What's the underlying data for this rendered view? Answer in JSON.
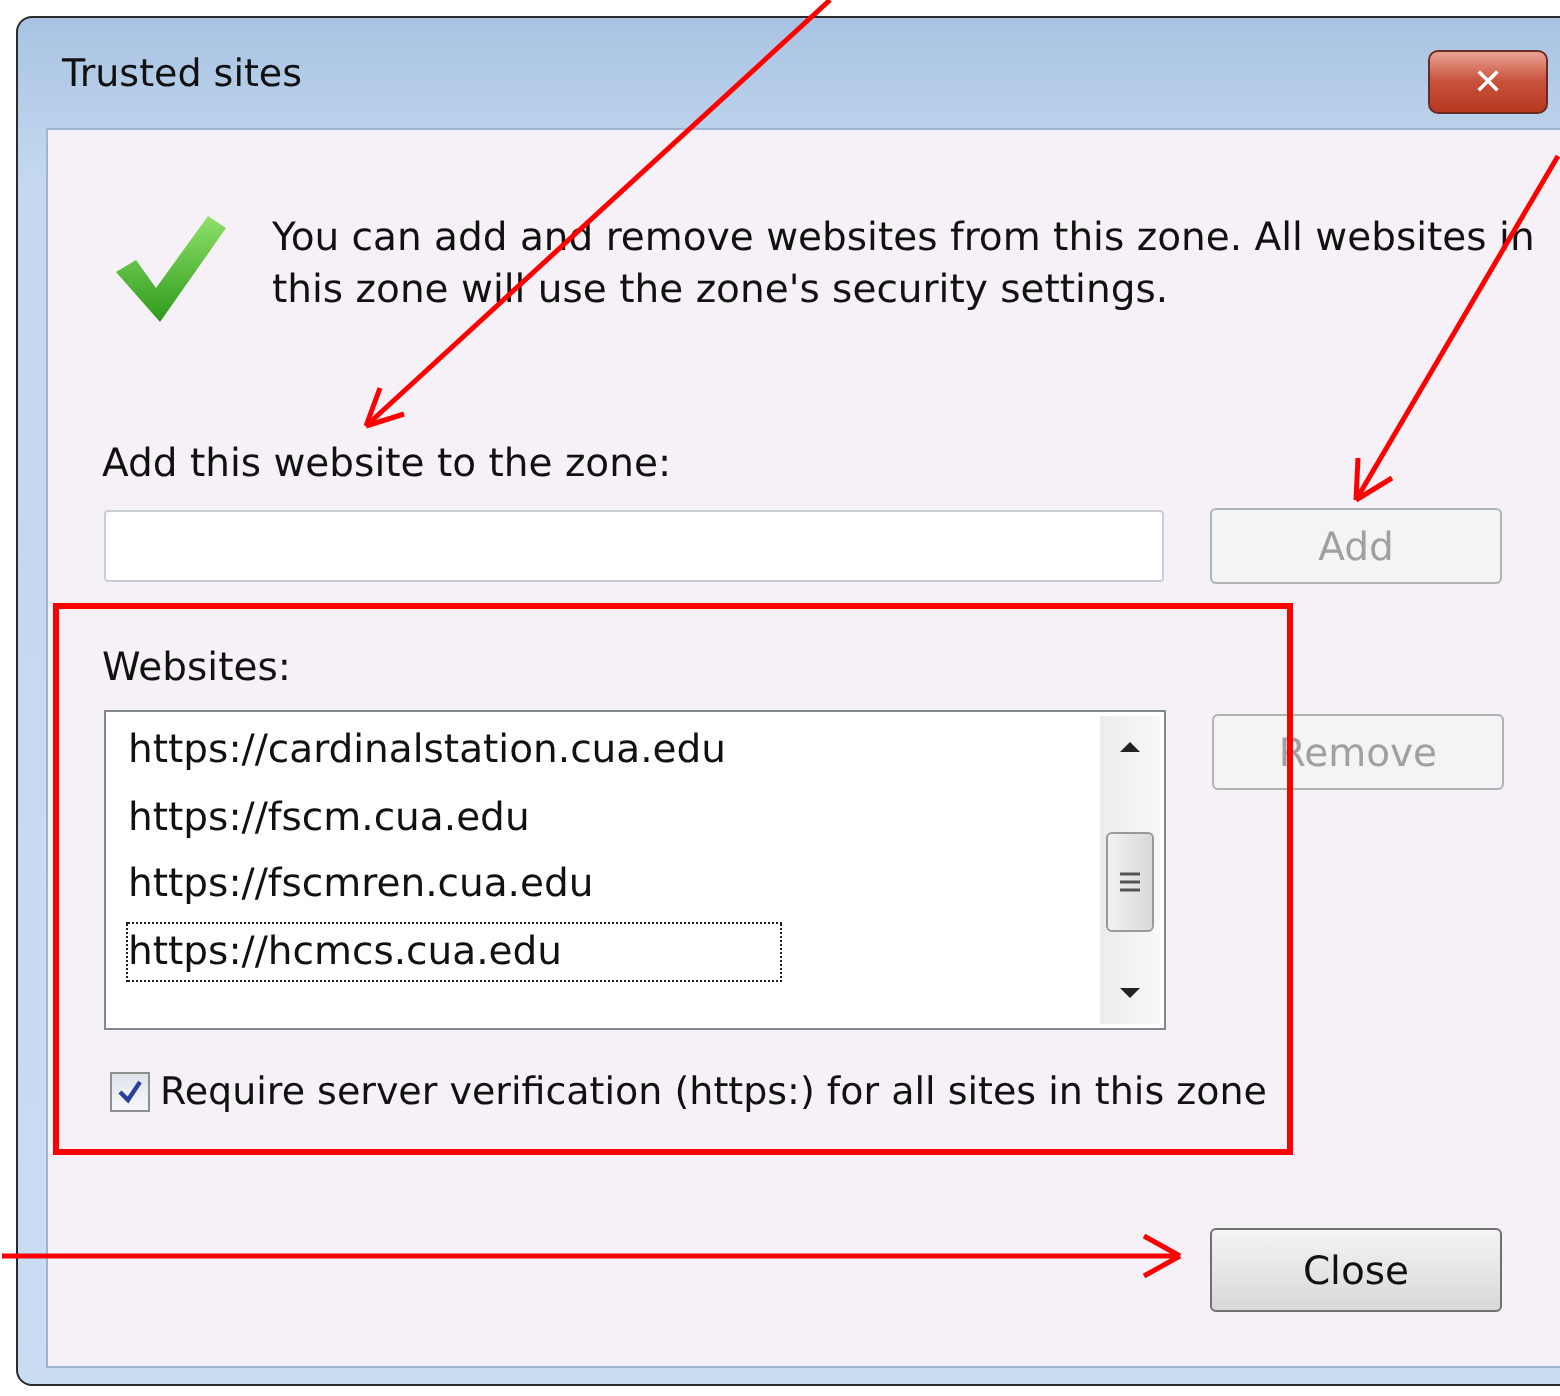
{
  "window": {
    "title": "Trusted sites",
    "close_symbol": "✕"
  },
  "message": "You can add and remove websites from this zone. All websites in this zone will use the zone's security settings.",
  "add_field": {
    "label": "Add this website to the zone:"
  },
  "add_button": {
    "label": "Add",
    "disabled": true
  },
  "websites": {
    "label": "Websites:",
    "items": [
      {
        "text": "https://cardinalstation.cua.edu",
        "focused": false
      },
      {
        "text": "https://fscm.cua.edu",
        "focused": false
      },
      {
        "text": "https://fscmren.cua.edu",
        "focused": false
      },
      {
        "text": "https://hcmcs.cua.edu",
        "focused": true
      }
    ]
  },
  "remove_button": {
    "label": "Remove",
    "disabled": true
  },
  "https_checkbox": {
    "label": "Require server verification (https:) for all sites in this zone",
    "checked": true
  },
  "close_button": {
    "label": "Close",
    "disabled": false
  }
}
